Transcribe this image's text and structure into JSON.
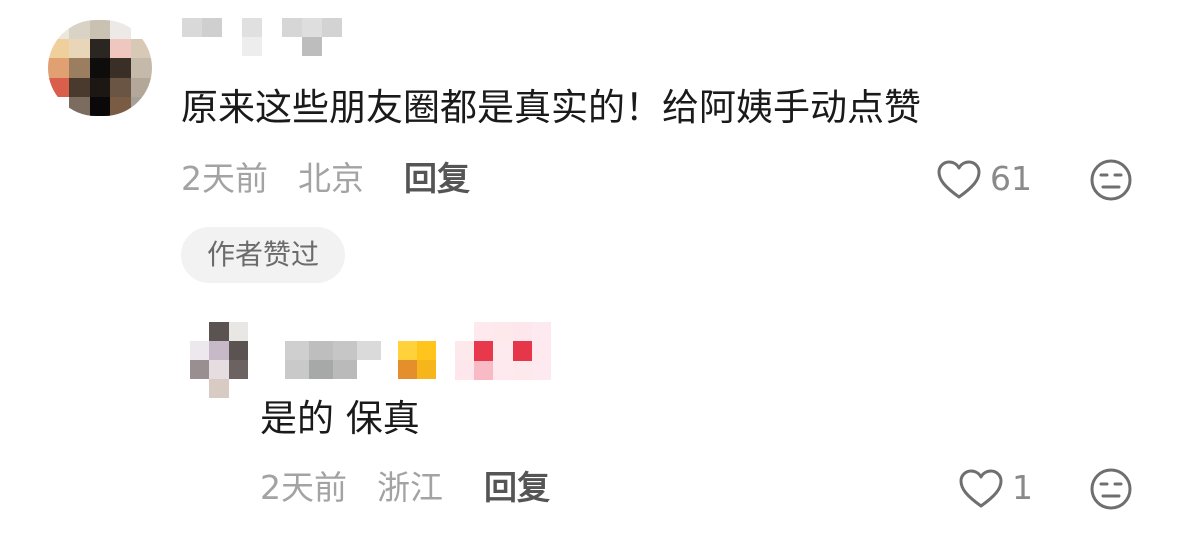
{
  "comment": {
    "text": "原来这些朋友圈都是真实的！给阿姨手动点赞",
    "time": "2天前",
    "location": "北京",
    "reply_label": "回复",
    "like_count": "61",
    "badge": "作者赞过"
  },
  "reply": {
    "text": "是的 保真",
    "time": "2天前",
    "location": "浙江",
    "reply_label": "回复",
    "like_count": "1"
  },
  "icons": {
    "like": "heart-outline-icon",
    "dislike": "neutral-face-icon"
  },
  "colors": {
    "text": "#1a1a1a",
    "meta": "#a3a3a3",
    "badge_bg": "#f2f2f2"
  }
}
